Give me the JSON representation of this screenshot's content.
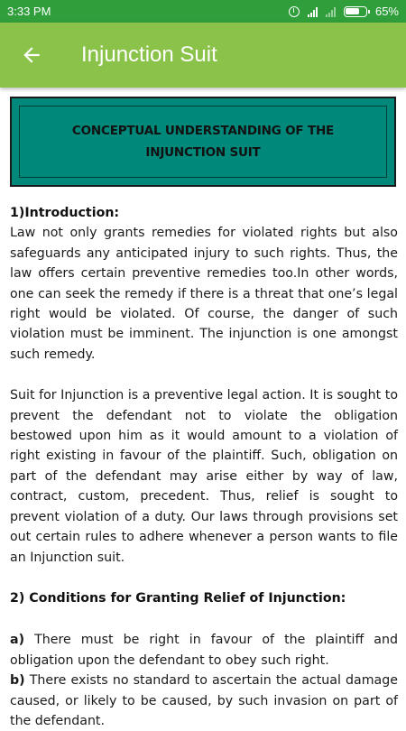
{
  "status_bar": {
    "time": "3:33 PM",
    "battery": "65%",
    "icons": [
      "alarm-icon",
      "signal-icon",
      "signal-icon",
      "battery-icon"
    ]
  },
  "app_bar": {
    "title": "Injunction Suit",
    "back_icon": "arrow-left-icon"
  },
  "banner": {
    "line1": "CONCEPTUAL UNDERSTANDING OF THE",
    "line2": "INJUNCTION SUIT",
    "color": "#00897b"
  },
  "content": {
    "intro_heading": "1)Introduction:",
    "intro_paragraph": "Law not only grants remedies for violated rights but also safeguards any anticipated injury to such rights. Thus, the law offers certain preventive remedies too.In other words, one can seek the remedy if there is a threat that one’s legal right would be violated. Of course, the danger of such violation must be imminent. The injunction is one amongst such remedy.",
    "suit_paragraph": "Suit for Injunction is a preventive legal action. It is sought to prevent the defendant not to violate the obligation bestowed upon him as it would amount to a violation of right existing in favour of the plaintiff. Such, obligation on part of the defendant may arise either by way of law, contract, custom, precedent. Thus, relief is sought to prevent violation of a duty. Our laws through provisions set out certain rules to adhere whenever a person wants to file an Injunction suit.",
    "conditions_heading": "2) Conditions for Granting Relief of Injunction:",
    "conditions": [
      {
        "marker": "a)",
        "text": " There must be right in favour of the plaintiff and obligation upon the defendant to obey such right."
      },
      {
        "marker": "b)",
        "text": " There exists no standard to ascertain the actual damage caused, or likely to be caused, by such invasion on part of the defendant."
      }
    ]
  },
  "colors": {
    "status_bar": "#2f9e3b",
    "app_bar": "#8bc34a"
  }
}
